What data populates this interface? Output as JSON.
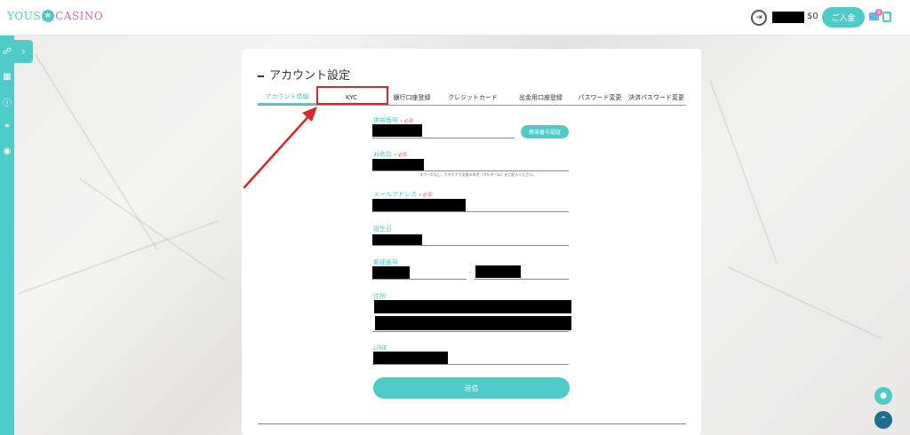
{
  "header": {
    "logo_part1": "YOUS",
    "logo_star": "★",
    "logo_part2": "CASINO",
    "balance_suffix": "$0",
    "deposit_label": "ご入金",
    "mail_badge": "9"
  },
  "sidebar": {
    "toggle_glyph": "›",
    "icons": [
      "gift-icon",
      "grid-icon",
      "info-icon",
      "link-icon",
      "globe-icon"
    ]
  },
  "account": {
    "title": "アカウント設定",
    "tabs": [
      "アカウント情報",
      "KYC",
      "銀行口座登録",
      "クレジットカード",
      "出金用口座登録",
      "パスワード変更",
      "決済パスワード変更"
    ],
    "active_tab": 0,
    "highlighted_tab": 1
  },
  "form": {
    "phone_label": "携帯番号",
    "required_mark": "• 必須",
    "verify_phone_label": "携帯番号認証",
    "name_label": "お名前",
    "name_note": "スペースなし、カタカナで全角の本名（フルネーム）をご記入ください。",
    "email_label": "メールアドレス",
    "birthday_label": "誕生日",
    "postal_label": "郵便番号",
    "postal_separator": "-",
    "address_label": "住所",
    "line_label": "LINE",
    "submit_label": "送信"
  },
  "colors": {
    "accent": "#4ecbc8",
    "brand_pink": "#d76aa8",
    "highlight_red": "#d62828",
    "scroll_top": "#1c6d8e"
  }
}
